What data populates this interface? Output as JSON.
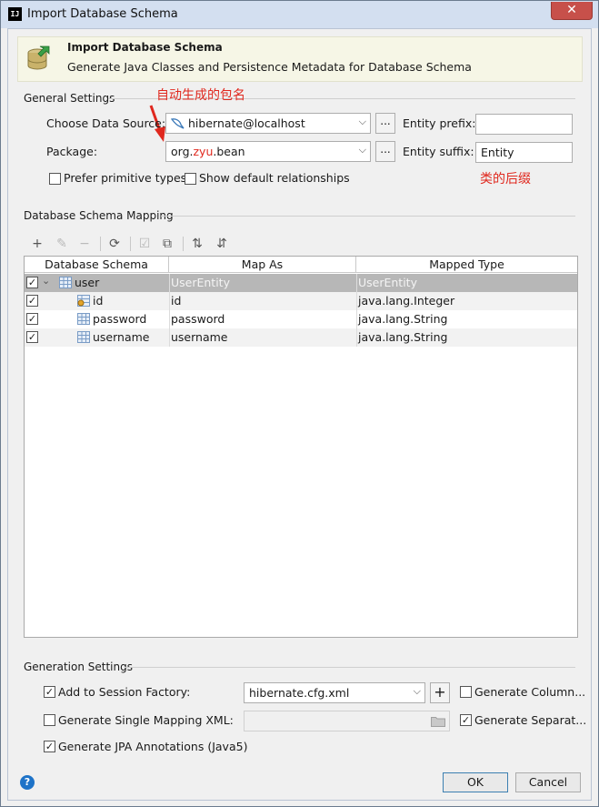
{
  "window": {
    "title": "Import Database Schema",
    "close_label": "✕"
  },
  "header": {
    "title": "Import Database Schema",
    "subtitle": "Generate Java Classes and Persistence Metadata for Database Schema"
  },
  "general": {
    "section_label": "General Settings",
    "data_source_label": "Choose Data Source:",
    "data_source_value": "hibernate@localhost",
    "package_label": "Package:",
    "package_prefix": "org.",
    "package_highlight": "zyu",
    "package_suffix": ".bean",
    "dots_label": "...",
    "entity_prefix_label": "Entity prefix:",
    "entity_prefix_value": "",
    "entity_suffix_label": "Entity suffix:",
    "entity_suffix_value": "Entity",
    "prefer_primitive_label": "Prefer primitive types",
    "show_relationships_label": "Show default relationships",
    "annotation_package": "自动生成的包名",
    "annotation_suffix": "类的后缀"
  },
  "mapping": {
    "section_label": "Database Schema Mapping",
    "columns": [
      "Database Schema",
      "Map As",
      "Mapped Type"
    ],
    "rows": [
      {
        "name": "user",
        "map_as": "UserEntity",
        "type": "UserEntity",
        "checked": true
      },
      {
        "name": "id",
        "map_as": "id",
        "type": "java.lang.Integer",
        "checked": true
      },
      {
        "name": "password",
        "map_as": "password",
        "type": "java.lang.String",
        "checked": true
      },
      {
        "name": "username",
        "map_as": "username",
        "type": "java.lang.String",
        "checked": true
      }
    ]
  },
  "generation": {
    "section_label": "Generation Settings",
    "add_session_label": "Add to Session Factory:",
    "session_factory_value": "hibernate.cfg.xml",
    "plus_label": "+",
    "generate_column_label": "Generate Column...",
    "single_mapping_label": "Generate Single Mapping XML:",
    "generate_separate_label": "Generate Separat...",
    "jpa_label": "Generate JPA Annotations (Java5)"
  },
  "footer": {
    "ok_label": "OK",
    "cancel_label": "Cancel",
    "help_label": "?"
  },
  "icons": {
    "check": "✓"
  }
}
